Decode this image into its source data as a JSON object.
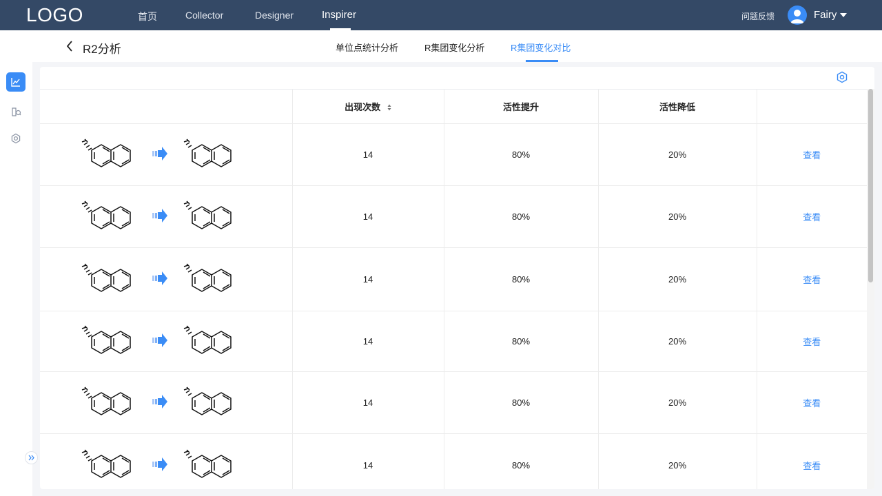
{
  "header": {
    "logo": "LOGO",
    "nav": [
      "首页",
      "Collector",
      "Designer",
      "Inspirer"
    ],
    "active_nav": "Inspirer",
    "feedback": "问题反馈",
    "username": "Fairy"
  },
  "subheader": {
    "title": "R2分析",
    "tabs": [
      "单位点统计分析",
      "R集团变化分析",
      "R集团变化对比"
    ],
    "active_tab": "R集团变化对比"
  },
  "table": {
    "columns": [
      "",
      "出现次数",
      "活性提升",
      "活性降低",
      ""
    ],
    "rows": [
      {
        "count": "14",
        "up": "80%",
        "down": "20%",
        "action": "查看"
      },
      {
        "count": "14",
        "up": "80%",
        "down": "20%",
        "action": "查看"
      },
      {
        "count": "14",
        "up": "80%",
        "down": "20%",
        "action": "查看"
      },
      {
        "count": "14",
        "up": "80%",
        "down": "20%",
        "action": "查看"
      },
      {
        "count": "14",
        "up": "80%",
        "down": "20%",
        "action": "查看"
      },
      {
        "count": "14",
        "up": "80%",
        "down": "20%",
        "action": "查看"
      }
    ]
  },
  "icons": {
    "sidebar": [
      "chart-icon",
      "molecule-book-icon",
      "gear-icon"
    ],
    "settings": "hexagon-settings-icon",
    "arrow": "transform-arrow-icon"
  },
  "colors": {
    "header_bg": "#344966",
    "accent": "#3a8cf6"
  }
}
